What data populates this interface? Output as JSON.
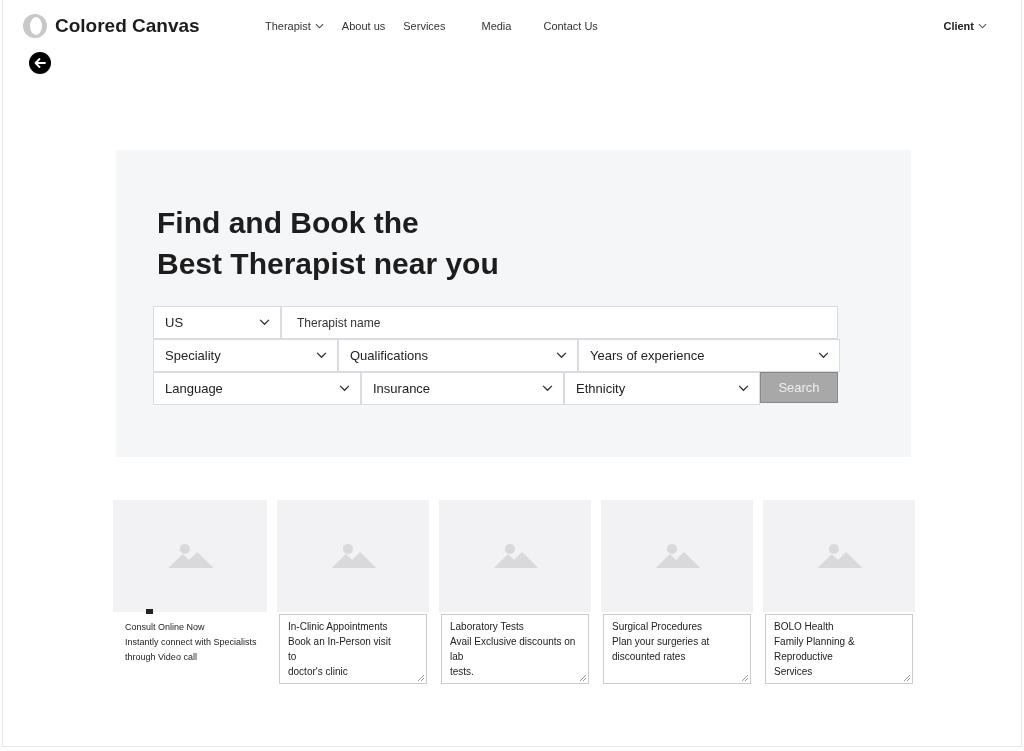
{
  "brand": {
    "name": "Colored Canvas"
  },
  "nav": [
    {
      "label": "Therapist",
      "dropdown": true
    },
    {
      "label": "About us",
      "dropdown": false
    },
    {
      "label": "Services",
      "dropdown": false
    },
    {
      "label": "Media",
      "dropdown": false
    },
    {
      "label": "Contact Us",
      "dropdown": false
    }
  ],
  "account": {
    "label": "Client"
  },
  "hero": {
    "title_lines": [
      "Find and Book the",
      "Best Therapist near you"
    ]
  },
  "search_form": {
    "rows": [
      [
        {
          "kind": "select",
          "value": "US"
        },
        {
          "kind": "input",
          "placeholder": "Therapist name"
        }
      ],
      [
        {
          "kind": "select",
          "value": "Speciality"
        },
        {
          "kind": "select",
          "value": "Qualifications"
        },
        {
          "kind": "select",
          "value": "Years of experience"
        }
      ],
      [
        {
          "kind": "select",
          "value": "Language"
        },
        {
          "kind": "select",
          "value": "Insurance"
        },
        {
          "kind": "select",
          "value": "Ethnicity"
        },
        {
          "kind": "button",
          "label": "Search",
          "disabled": true
        }
      ]
    ]
  },
  "cards": [
    {
      "kind": "plain",
      "text": "Consult Online Now\nInstantly connect with Specialists\nthrough Video call"
    },
    {
      "kind": "textarea",
      "text": "In-Clinic Appointments\nBook an In-Person visit\nto\ndoctor's clinic"
    },
    {
      "kind": "textarea",
      "text": "Laboratory Tests\nAvail Exclusive discounts on\nlab\ntests."
    },
    {
      "kind": "textarea",
      "text": "Surgical Procedures\nPlan your surgeries at\ndiscounted rates"
    },
    {
      "kind": "textarea",
      "text": "BOLO Health\nFamily Planning &\nReproductive\nServices"
    }
  ]
}
